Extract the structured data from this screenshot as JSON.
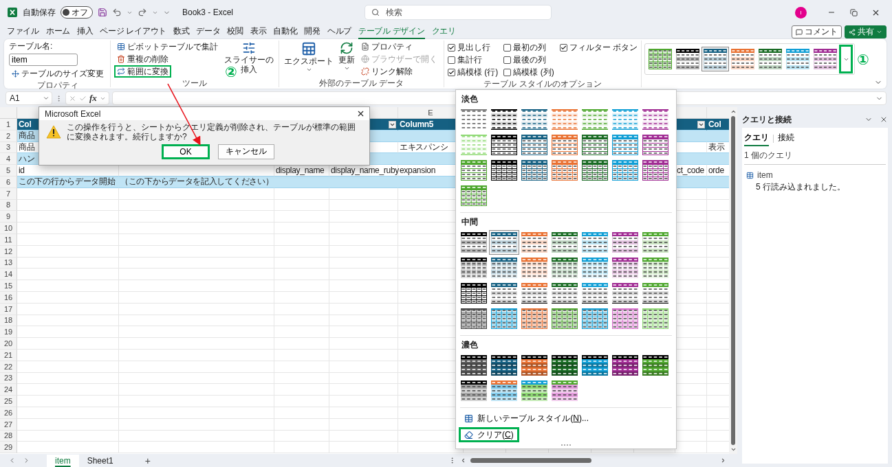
{
  "titlebar": {
    "autosave_label": "自動保存",
    "autosave": {
      "on": false,
      "label": "オフ"
    },
    "title": "Book3 - Excel",
    "search_placeholder": "検索",
    "avatar": "I"
  },
  "top_buttons": [
    {
      "kind": "comment",
      "label": "コメント"
    },
    {
      "kind": "share",
      "label": "共有"
    }
  ],
  "menu": [
    {
      "label": "ファイル",
      "selected": false,
      "contextual": false
    },
    {
      "label": "ホーム",
      "selected": false,
      "contextual": false
    },
    {
      "label": "挿入",
      "selected": false,
      "contextual": false
    },
    {
      "label": "ページ レイアウト",
      "selected": false,
      "contextual": false
    },
    {
      "label": "数式",
      "selected": false,
      "contextual": false
    },
    {
      "label": "データ",
      "selected": false,
      "contextual": false
    },
    {
      "label": "校閲",
      "selected": false,
      "contextual": false
    },
    {
      "label": "表示",
      "selected": false,
      "contextual": false
    },
    {
      "label": "自動化",
      "selected": false,
      "contextual": false
    },
    {
      "label": "開発",
      "selected": false,
      "contextual": false
    },
    {
      "label": "ヘルプ",
      "selected": false,
      "contextual": false
    },
    {
      "label": "テーブル デザイン",
      "selected": true,
      "contextual": true
    },
    {
      "label": "クエリ",
      "selected": false,
      "contextual": true
    }
  ],
  "ribbon": {
    "properties": {
      "title": "プロパティ",
      "name_label": "テーブル名:",
      "name_value": "item",
      "resize": "テーブルのサイズ変更"
    },
    "tools": {
      "title": "ツール",
      "items": [
        {
          "kind": "pivot",
          "label": "ピボットテーブルで集計",
          "highlighted": false
        },
        {
          "kind": "dedupe",
          "label": "重複の削除",
          "highlighted": false
        },
        {
          "kind": "convert",
          "label": "範囲に変換",
          "highlighted": true
        }
      ],
      "step": "②",
      "slicer": [
        "スライサーの",
        "挿入"
      ]
    },
    "external": {
      "title": "外部のテーブル データ",
      "export": "エクスポート",
      "refresh": "更新",
      "items": [
        {
          "kind": "properties",
          "label": "プロパティ",
          "disabled": false
        },
        {
          "kind": "browser",
          "label": "ブラウザーで開く",
          "disabled": true
        },
        {
          "kind": "unlink",
          "label": "リンク解除",
          "disabled": false
        }
      ]
    },
    "options": {
      "title": "テーブル スタイルのオプション",
      "checks": [
        {
          "label": "見出し行",
          "checked": true
        },
        {
          "label": "集計行",
          "checked": false
        },
        {
          "label": "縞模様 (行)",
          "checked": true
        },
        {
          "label": "最初の列",
          "checked": false
        },
        {
          "label": "最後の列",
          "checked": false
        },
        {
          "label": "縞模様 (列)",
          "checked": false
        },
        {
          "label": "フィルター ボタン",
          "checked": true
        }
      ]
    },
    "quick_styles": {
      "step": "①",
      "more_highlighted": true,
      "swatches": [
        {
          "kind": "tintgrid",
          "color": "#4ea72e",
          "selected": false
        },
        {
          "kind": "banded",
          "color": "#000000",
          "selected": false
        },
        {
          "kind": "banded",
          "color": "#156082",
          "selected": true
        },
        {
          "kind": "banded",
          "color": "#e97132",
          "selected": false
        },
        {
          "kind": "banded",
          "color": "#196b24",
          "selected": false
        },
        {
          "kind": "banded",
          "color": "#0f9ed5",
          "selected": false
        },
        {
          "kind": "banded",
          "color": "#a02b93",
          "selected": false
        }
      ]
    }
  },
  "formula_bar": {
    "name_box": "A1",
    "fx": "fx"
  },
  "sheet": {
    "column_headers": {
      "E": "E"
    },
    "rows": [
      {
        "number": "1",
        "kind": "header",
        "cells": {
          "A": {
            "text": "Col"
          },
          "D": {
            "filter": true
          },
          "E": {
            "text": "Column5"
          },
          "K": {
            "filter": true
          },
          "L": {
            "text": "Col"
          }
        }
      },
      {
        "number": "2",
        "kind": "band",
        "cells": {
          "A": {
            "text": "商品"
          }
        }
      },
      {
        "number": "3",
        "kind": "plain",
        "cells": {
          "A": {
            "text": "商品"
          },
          "E": {
            "text": "エキスパンシ"
          },
          "L": {
            "text": "表示"
          }
        }
      },
      {
        "number": "4",
        "kind": "band",
        "cells": {
          "A": {
            "text": "ハン"
          }
        }
      },
      {
        "number": "5",
        "kind": "plain",
        "cells": {
          "A": {
            "text": "id"
          },
          "C": {
            "text": "display_name"
          },
          "D": {
            "text": "display_name_ruby"
          },
          "E": {
            "text": "expansion"
          },
          "K": {
            "text": "ct_code"
          },
          "L": {
            "text": "orde"
          }
        }
      },
      {
        "number": "6",
        "kind": "band",
        "cells": {
          "A": {
            "text": "この下の行からデータ開始"
          },
          "B": {
            "text": "（この下からデータを記入してください）"
          }
        }
      },
      {
        "number": "7",
        "kind": "empty"
      },
      {
        "number": "8",
        "kind": "empty"
      },
      {
        "number": "9",
        "kind": "empty"
      },
      {
        "number": "10",
        "kind": "empty"
      },
      {
        "number": "11",
        "kind": "empty"
      },
      {
        "number": "12",
        "kind": "empty"
      },
      {
        "number": "13",
        "kind": "empty"
      },
      {
        "number": "14",
        "kind": "empty"
      },
      {
        "number": "15",
        "kind": "empty"
      },
      {
        "number": "16",
        "kind": "empty"
      },
      {
        "number": "17",
        "kind": "empty"
      },
      {
        "number": "18",
        "kind": "empty"
      },
      {
        "number": "19",
        "kind": "empty"
      },
      {
        "number": "20",
        "kind": "empty"
      },
      {
        "number": "21",
        "kind": "empty"
      },
      {
        "number": "22",
        "kind": "empty"
      },
      {
        "number": "23",
        "kind": "empty"
      },
      {
        "number": "24",
        "kind": "empty"
      },
      {
        "number": "25",
        "kind": "empty"
      },
      {
        "number": "26",
        "kind": "empty"
      },
      {
        "number": "27",
        "kind": "empty"
      },
      {
        "number": "28",
        "kind": "empty"
      },
      {
        "number": "29",
        "kind": "empty"
      }
    ]
  },
  "sheet_tabs": [
    {
      "label": "item",
      "selected": true
    },
    {
      "label": "Sheet1",
      "selected": false
    }
  ],
  "add_sheet": "+",
  "dialog": {
    "title": "Microsoft Excel",
    "message": "この操作を行うと、シートからクエリ定義が削除され、テーブルが標準の範囲に変換されます。続行しますか?",
    "buttons": [
      {
        "label": "OK",
        "highlighted": true
      },
      {
        "label": "キャンセル",
        "highlighted": false
      }
    ]
  },
  "style_gallery": {
    "sections": [
      {
        "title": "淡色",
        "swatches": [
          {
            "kind": "plain",
            "color": "#7f7f7f",
            "selected": false
          },
          {
            "kind": "lines",
            "color": "#000000",
            "selected": false
          },
          {
            "kind": "lines",
            "color": "#156082",
            "selected": false
          },
          {
            "kind": "lines",
            "color": "#e97132",
            "selected": false
          },
          {
            "kind": "lines",
            "color": "#4ea72e",
            "selected": false
          },
          {
            "kind": "lines",
            "color": "#0f9ed5",
            "selected": false
          },
          {
            "kind": "lines",
            "color": "#a02b93",
            "selected": false
          },
          {
            "kind": "lines",
            "color": "#8ed973",
            "selected": false
          },
          {
            "kind": "header",
            "color": "#000000",
            "selected": false
          },
          {
            "kind": "header",
            "color": "#156082",
            "selected": false
          },
          {
            "kind": "header",
            "color": "#e97132",
            "selected": false
          },
          {
            "kind": "header",
            "color": "#196b24",
            "selected": false
          },
          {
            "kind": "header",
            "color": "#0f9ed5",
            "selected": false
          },
          {
            "kind": "header",
            "color": "#a02b93",
            "selected": false
          },
          {
            "kind": "header",
            "color": "#4ea72e",
            "selected": false
          },
          {
            "kind": "grid",
            "color": "#000000",
            "selected": false
          },
          {
            "kind": "grid",
            "color": "#156082",
            "selected": false
          },
          {
            "kind": "grid",
            "color": "#e97132",
            "selected": false
          },
          {
            "kind": "grid",
            "color": "#196b24",
            "selected": false
          },
          {
            "kind": "grid",
            "color": "#0f9ed5",
            "selected": false
          },
          {
            "kind": "grid",
            "color": "#a02b93",
            "selected": false
          },
          {
            "kind": "grid",
            "color": "#4ea72e",
            "selected": false
          }
        ]
      },
      {
        "title": "中間",
        "swatches": [
          {
            "kind": "banded",
            "color": "#000000",
            "selected": false
          },
          {
            "kind": "banded",
            "color": "#156082",
            "selected": true
          },
          {
            "kind": "banded",
            "color": "#e97132",
            "selected": false
          },
          {
            "kind": "banded",
            "color": "#196b24",
            "selected": false
          },
          {
            "kind": "banded",
            "color": "#0f9ed5",
            "selected": false
          },
          {
            "kind": "banded",
            "color": "#a02b93",
            "selected": false
          },
          {
            "kind": "banded",
            "color": "#4ea72e",
            "selected": false
          },
          {
            "kind": "gridbanded",
            "color": "#000000",
            "selected": false
          },
          {
            "kind": "gridbanded",
            "color": "#156082",
            "selected": false
          },
          {
            "kind": "gridbanded",
            "color": "#e97132",
            "selected": false
          },
          {
            "kind": "gridbanded",
            "color": "#196b24",
            "selected": false
          },
          {
            "kind": "gridbanded",
            "color": "#0f9ed5",
            "selected": false
          },
          {
            "kind": "gridbanded",
            "color": "#a02b93",
            "selected": false
          },
          {
            "kind": "gridbanded",
            "color": "#4ea72e",
            "selected": false
          },
          {
            "kind": "grid",
            "color": "#000000",
            "selected": false
          },
          {
            "kind": "graybands",
            "color": "#156082",
            "selected": false
          },
          {
            "kind": "graybands",
            "color": "#e97132",
            "selected": false
          },
          {
            "kind": "graybands",
            "color": "#196b24",
            "selected": false
          },
          {
            "kind": "graybands",
            "color": "#0f9ed5",
            "selected": false
          },
          {
            "kind": "graybands",
            "color": "#a02b93",
            "selected": false
          },
          {
            "kind": "graybands",
            "color": "#4ea72e",
            "selected": false
          },
          {
            "kind": "tintgrid",
            "color": "#404040",
            "selected": false
          },
          {
            "kind": "tintgrid",
            "color": "#0f9ed5",
            "selected": false
          },
          {
            "kind": "tintgrid",
            "color": "#e97132",
            "selected": false
          },
          {
            "kind": "tintgrid",
            "color": "#4ea72e",
            "selected": false
          },
          {
            "kind": "tintgrid",
            "color": "#0f9ed5",
            "selected": false
          },
          {
            "kind": "tintgrid",
            "color": "#d86ecc",
            "selected": false
          },
          {
            "kind": "tintgrid",
            "color": "#8ed973",
            "selected": false
          }
        ]
      },
      {
        "title": "濃色",
        "swatches": [
          {
            "kind": "dark",
            "color": "#595959",
            "selected": false
          },
          {
            "kind": "dark",
            "color": "#156082",
            "selected": false
          },
          {
            "kind": "dark",
            "color": "#e97132",
            "selected": false
          },
          {
            "kind": "dark",
            "color": "#196b24",
            "selected": false
          },
          {
            "kind": "dark",
            "color": "#0f9ed5",
            "selected": false
          },
          {
            "kind": "dark",
            "color": "#a02b93",
            "selected": false
          },
          {
            "kind": "dark",
            "color": "#4ea72e",
            "selected": false
          },
          {
            "kind": "twotone",
            "color": "#000000",
            "body": {
              "color": "#a6a6a6"
            },
            "selected": false
          },
          {
            "kind": "twotone",
            "color": "#e97132",
            "body": {
              "color": "#83cbeb"
            },
            "selected": false
          },
          {
            "kind": "twotone",
            "color": "#0f9ed5",
            "body": {
              "color": "#8ed973"
            },
            "selected": false
          },
          {
            "kind": "twotone",
            "color": "#4ea72e",
            "body": {
              "color": "#e49edd"
            },
            "selected": false
          }
        ]
      }
    ],
    "commands": [
      {
        "kind": "new",
        "before": "新しいテーブル スタイル(",
        "key": "N",
        "after": ")...",
        "highlighted": false
      },
      {
        "kind": "clear",
        "before": "クリア(",
        "key": "C",
        "after": ")",
        "highlighted": true
      }
    ]
  },
  "query_panel": {
    "title": "クエリと接続",
    "tabs": [
      {
        "label": "クエリ",
        "selected": true
      },
      {
        "label": "接続",
        "selected": false
      }
    ],
    "count": "1 個のクエリ",
    "queries": [
      {
        "name": "item",
        "status": "5 行読み込まれました。"
      }
    ]
  }
}
